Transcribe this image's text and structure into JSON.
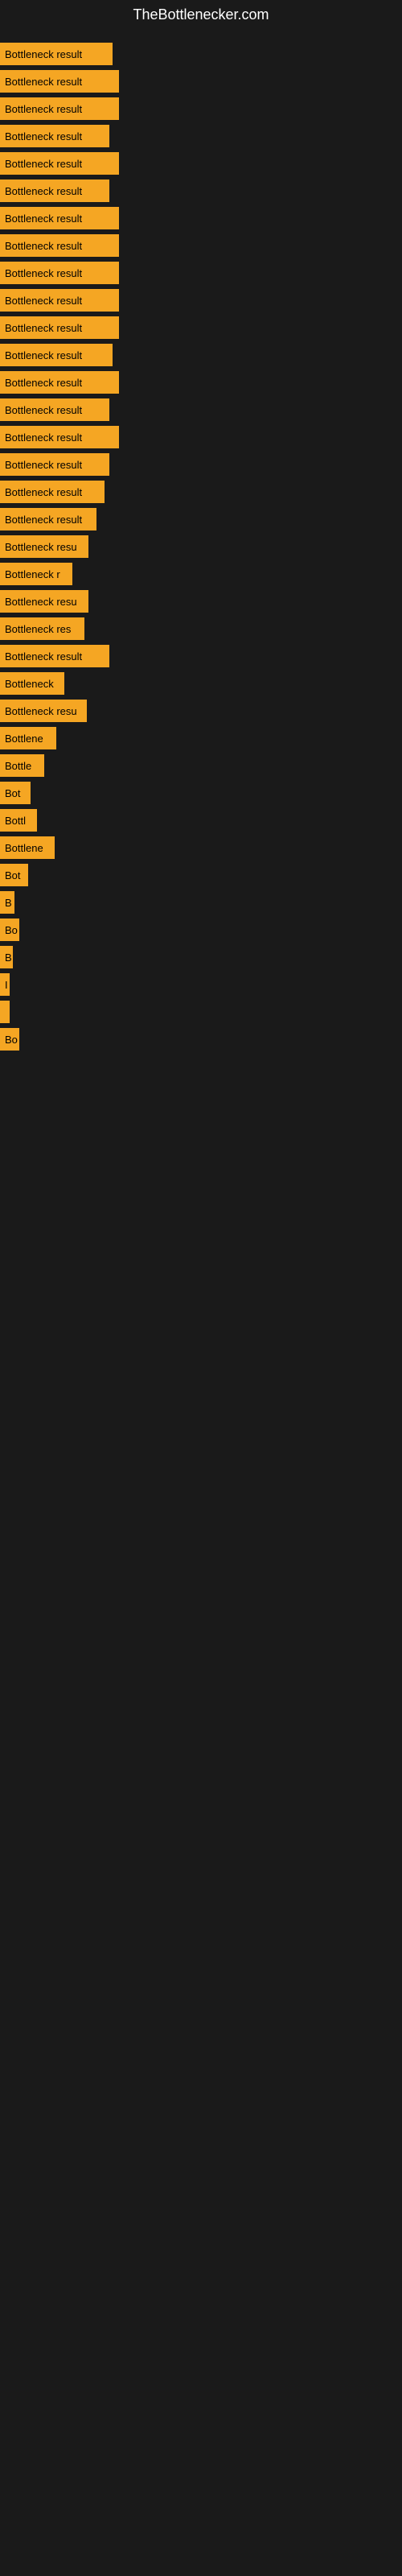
{
  "site": {
    "title": "TheBottlenecker.com"
  },
  "bars": [
    {
      "label": "Bottleneck result",
      "width": 140
    },
    {
      "label": "Bottleneck result",
      "width": 148
    },
    {
      "label": "Bottleneck result",
      "width": 148
    },
    {
      "label": "Bottleneck result",
      "width": 136
    },
    {
      "label": "Bottleneck result",
      "width": 148
    },
    {
      "label": "Bottleneck result",
      "width": 136
    },
    {
      "label": "Bottleneck result",
      "width": 148
    },
    {
      "label": "Bottleneck result",
      "width": 148
    },
    {
      "label": "Bottleneck result",
      "width": 148
    },
    {
      "label": "Bottleneck result",
      "width": 148
    },
    {
      "label": "Bottleneck result",
      "width": 148
    },
    {
      "label": "Bottleneck result",
      "width": 140
    },
    {
      "label": "Bottleneck result",
      "width": 148
    },
    {
      "label": "Bottleneck result",
      "width": 136
    },
    {
      "label": "Bottleneck result",
      "width": 148
    },
    {
      "label": "Bottleneck result",
      "width": 136
    },
    {
      "label": "Bottleneck result",
      "width": 130
    },
    {
      "label": "Bottleneck result",
      "width": 120
    },
    {
      "label": "Bottleneck resu",
      "width": 110
    },
    {
      "label": "Bottleneck r",
      "width": 90
    },
    {
      "label": "Bottleneck resu",
      "width": 110
    },
    {
      "label": "Bottleneck res",
      "width": 105
    },
    {
      "label": "Bottleneck result",
      "width": 136
    },
    {
      "label": "Bottleneck",
      "width": 80
    },
    {
      "label": "Bottleneck resu",
      "width": 108
    },
    {
      "label": "Bottlene",
      "width": 70
    },
    {
      "label": "Bottle",
      "width": 55
    },
    {
      "label": "Bot",
      "width": 38
    },
    {
      "label": "Bottl",
      "width": 46
    },
    {
      "label": "Bottlene",
      "width": 68
    },
    {
      "label": "Bot",
      "width": 35
    },
    {
      "label": "B",
      "width": 18
    },
    {
      "label": "Bo",
      "width": 24
    },
    {
      "label": "B",
      "width": 16
    },
    {
      "label": "I",
      "width": 8
    },
    {
      "label": "",
      "width": 4
    },
    {
      "label": "Bo",
      "width": 24
    }
  ]
}
